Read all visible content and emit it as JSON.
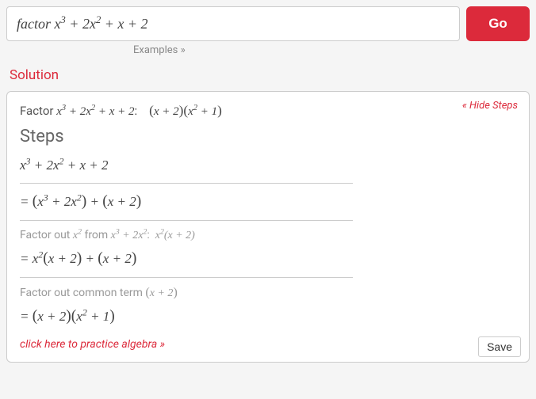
{
  "search": {
    "query_html": "<span class='math'>factor x<sup>3</sup> + 2x<sup>2</sup> + x + 2</span>",
    "go_label": "Go",
    "examples_label": "Examples »"
  },
  "solution_label": "Solution",
  "card": {
    "hide_steps": "« Hide Steps",
    "problem_label": "Factor",
    "problem_expr_html": "<span class='math'>x<sup>3</sup> + 2x<sup>2</sup> + x + 2</span>:",
    "result_html": "<span class='math'><span class='paren'>(</span>x + 2<span class='paren'>)(</span>x<sup>2</sup> + 1<span class='paren'>)</span></span>",
    "steps_heading": "Steps",
    "steps": [
      {
        "type": "expr",
        "html": "<span class='math'>x<sup>3</sup> + 2x<sup>2</sup> + x + 2</span>"
      },
      {
        "type": "divider"
      },
      {
        "type": "expr",
        "html": "<span class='math'>= <span class='paren'>(</span>x<sup>3</sup> + 2x<sup>2</sup><span class='paren'>)</span> + <span class='paren'>(</span>x + 2<span class='paren'>)</span></span>"
      },
      {
        "type": "divider"
      },
      {
        "type": "hint",
        "html": "Factor out <span class='math'>x<sup>2</sup></span> from <span class='math'>x<sup>3</sup> + 2x<sup>2</sup></span>:&nbsp;&nbsp;<span class='math'>x<sup>2</sup>(x + 2)</span>"
      },
      {
        "type": "expr",
        "html": "<span class='math'>= x<sup>2</sup><span class='paren'>(</span>x + 2<span class='paren'>)</span> + <span class='paren'>(</span>x + 2<span class='paren'>)</span></span>"
      },
      {
        "type": "divider"
      },
      {
        "type": "hint",
        "html": "Factor out common term <span class='math'><span class='paren'>(</span>x + 2<span class='paren'>)</span></span>"
      },
      {
        "type": "expr",
        "html": "<span class='math'>= <span class='paren'>(</span>x + 2<span class='paren'>)(</span>x<sup>2</sup> + 1<span class='paren'>)</span></span>"
      }
    ],
    "practice_link": "click here to practice algebra »",
    "save_label": "Save"
  }
}
